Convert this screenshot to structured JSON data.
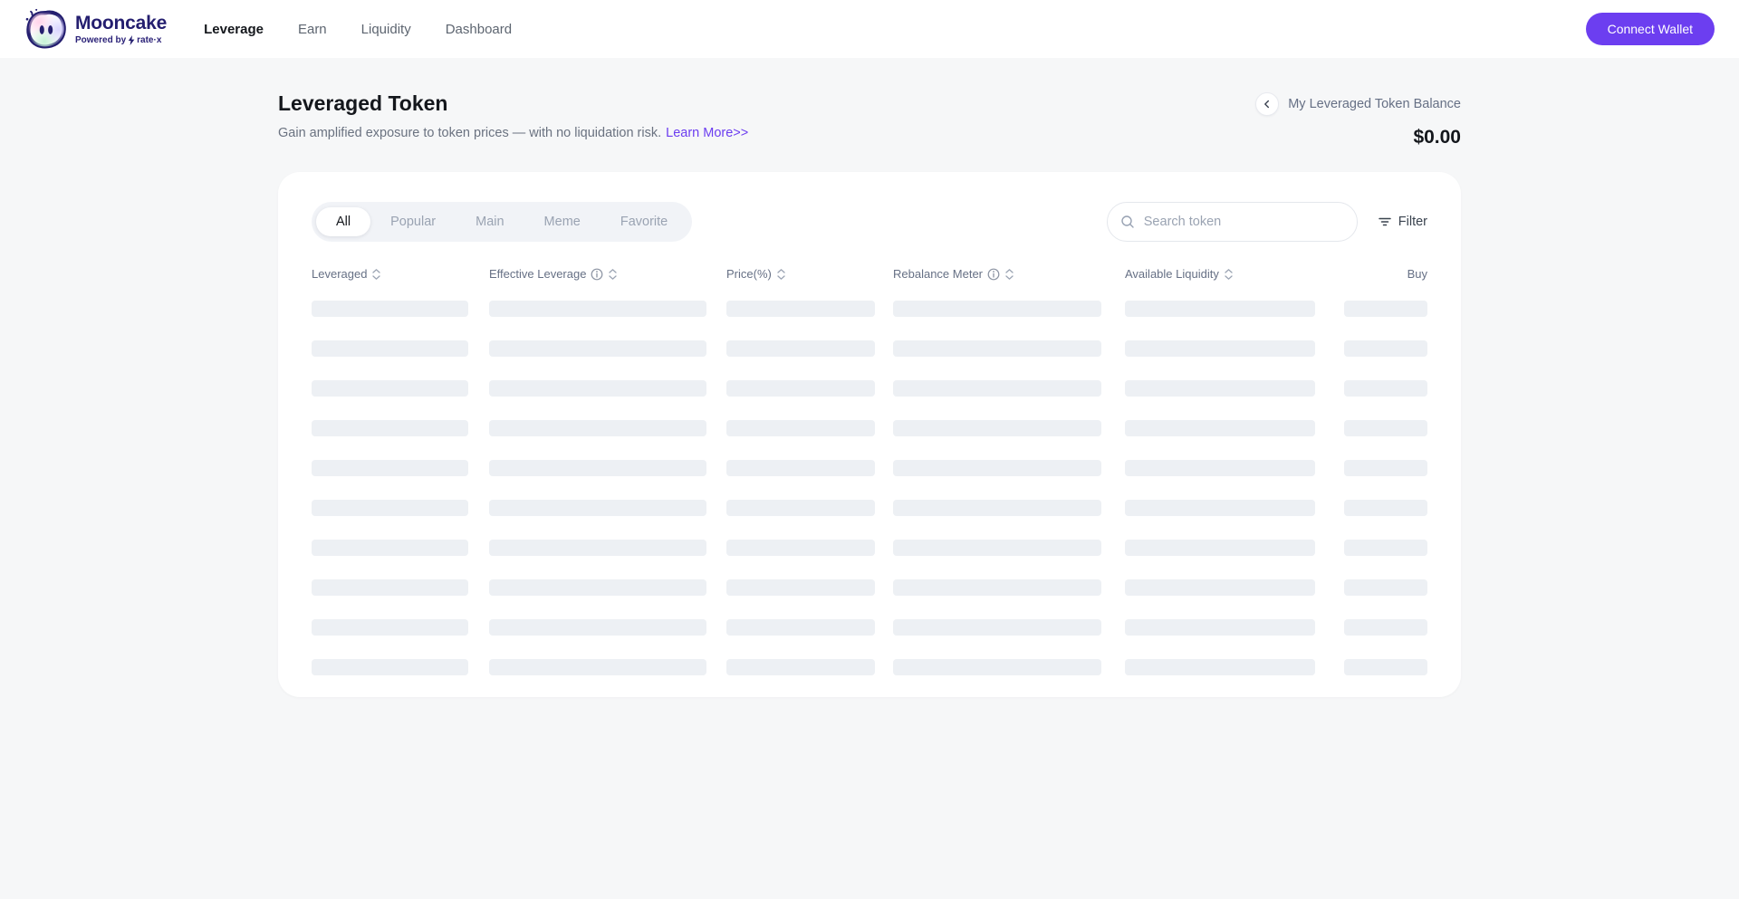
{
  "brand": {
    "name": "Mooncake",
    "tagline_prefix": "Powered by",
    "tagline_brand": "rate·x"
  },
  "nav": {
    "items": [
      {
        "label": "Leverage",
        "active": true
      },
      {
        "label": "Earn",
        "active": false
      },
      {
        "label": "Liquidity",
        "active": false
      },
      {
        "label": "Dashboard",
        "active": false
      }
    ],
    "connect_wallet_label": "Connect Wallet"
  },
  "page": {
    "title": "Leveraged Token",
    "subtitle": "Gain amplified exposure to token prices — with no liquidation risk.",
    "learn_more_label": "Learn More>>",
    "balance_label": "My Leveraged Token Balance",
    "balance_value": "$0.00"
  },
  "filters": {
    "tabs": [
      "All",
      "Popular",
      "Main",
      "Meme",
      "Favorite"
    ],
    "active_tab": "All",
    "search_placeholder": "Search token",
    "filter_label": "Filter"
  },
  "table": {
    "columns": [
      {
        "label": "Leveraged",
        "sortable": true,
        "info": false
      },
      {
        "label": "Effective Leverage",
        "sortable": true,
        "info": true
      },
      {
        "label": "Price(%)",
        "sortable": true,
        "info": false
      },
      {
        "label": "Rebalance Meter",
        "sortable": true,
        "info": true
      },
      {
        "label": "Available Liquidity",
        "sortable": true,
        "info": false
      },
      {
        "label": "Buy",
        "sortable": false,
        "info": false
      }
    ],
    "state": "loading-skeleton",
    "skeleton_rows": 10
  },
  "icons": {
    "back": "chevron-left",
    "search": "magnifier",
    "filter": "filter-lines",
    "sort": "sort-chevrons",
    "info": "info-circle",
    "logo": "mooncake-mascot"
  },
  "colors": {
    "accent": "#6C3EF0",
    "brand_navy": "#241E6F",
    "page_bg": "#F6F7F8",
    "card_bg": "#FFFFFF",
    "skeleton": "#EDF0F4",
    "muted_text": "#667085"
  }
}
